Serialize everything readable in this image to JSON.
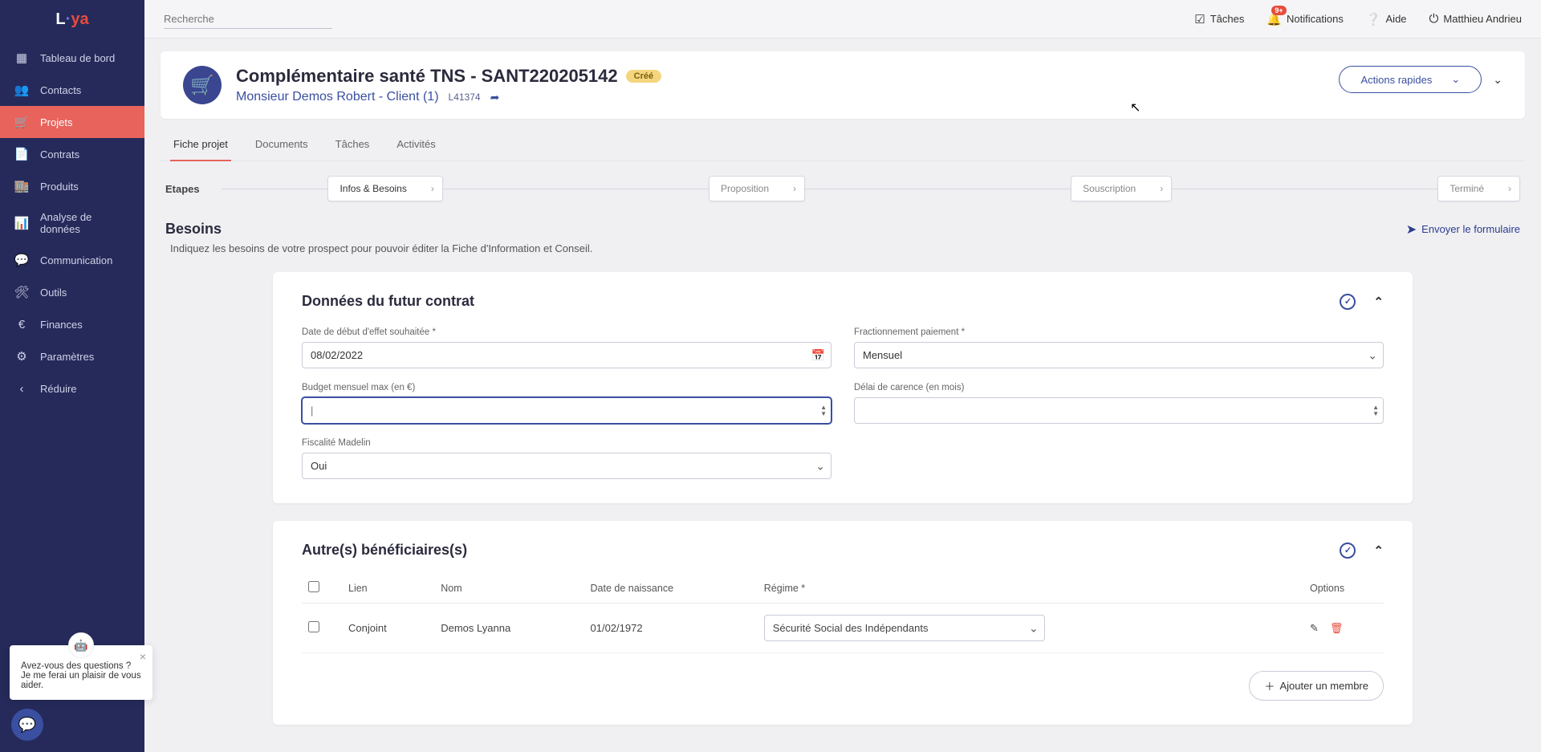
{
  "logo": {
    "l": "L",
    "y": "y",
    "a": "a"
  },
  "sidebar": {
    "items": [
      {
        "icon": "▦",
        "label": "Tableau de bord"
      },
      {
        "icon": "👥",
        "label": "Contacts"
      },
      {
        "icon": "🛒",
        "label": "Projets"
      },
      {
        "icon": "📄",
        "label": "Contrats"
      },
      {
        "icon": "🏬",
        "label": "Produits"
      },
      {
        "icon": "📊",
        "label": "Analyse de données"
      },
      {
        "icon": "💬",
        "label": "Communication"
      },
      {
        "icon": "🛠",
        "label": "Outils"
      },
      {
        "icon": "€",
        "label": "Finances"
      },
      {
        "icon": "⚙",
        "label": "Paramètres"
      },
      {
        "icon": "‹",
        "label": "Réduire"
      }
    ]
  },
  "topbar": {
    "search_placeholder": "Recherche",
    "tasks": "Tâches",
    "notifications": "Notifications",
    "notifications_badge": "9+",
    "help": "Aide",
    "user": "Matthieu Andrieu"
  },
  "header": {
    "title": "Complémentaire santé TNS - SANT220205142",
    "status": "Créé",
    "subtitle": "Monsieur Demos Robert - Client (1)",
    "client_id": "L41374",
    "actions_label": "Actions rapides"
  },
  "tabs": [
    "Fiche projet",
    "Documents",
    "Tâches",
    "Activités"
  ],
  "steps": {
    "label": "Etapes",
    "items": [
      "Infos & Besoins",
      "Proposition",
      "Souscription",
      "Terminé"
    ]
  },
  "besoins": {
    "title": "Besoins",
    "send": "Envoyer le formulaire",
    "desc": "Indiquez les besoins de votre prospect pour pouvoir éditer la Fiche d'Information et Conseil."
  },
  "card1": {
    "title": "Données du futur contrat",
    "fields": {
      "date_label": "Date de début d'effet souhaitée *",
      "date_value": "08/02/2022",
      "frac_label": "Fractionnement paiement *",
      "frac_value": "Mensuel",
      "budget_label": "Budget mensuel max (en €)",
      "budget_value": "",
      "delai_label": "Délai de carence (en mois)",
      "delai_value": "",
      "fisc_label": "Fiscalité Madelin",
      "fisc_value": "Oui"
    }
  },
  "card2": {
    "title": "Autre(s) bénéficiaires(s)",
    "columns": {
      "lien": "Lien",
      "nom": "Nom",
      "dob": "Date de naissance",
      "regime": "Régime *",
      "options": "Options"
    },
    "rows": [
      {
        "lien": "Conjoint",
        "nom": "Demos Lyanna",
        "dob": "01/02/1972",
        "regime": "Sécurité Social des Indépendants"
      }
    ],
    "add_label": "Ajouter un membre"
  },
  "chat": {
    "text": "Avez-vous des questions ? Je me ferai un plaisir de vous aider."
  }
}
